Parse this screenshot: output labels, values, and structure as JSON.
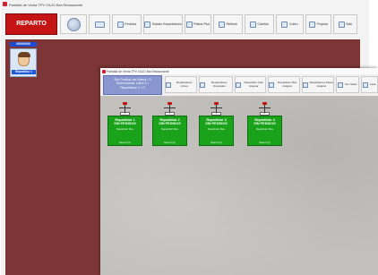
{
  "window_back": {
    "title": "Pantalla de Venta TPV XAJO Bar-Restaurante",
    "reparto_label": "REPARTO",
    "toolbar": [
      {
        "id": "home",
        "label": "",
        "icon": "round-logo-icon"
      },
      {
        "id": "keyboard",
        "label": "",
        "icon": "keyboard-icon"
      },
      {
        "id": "pedidos",
        "label": "Pedidos",
        "icon": "list-icon"
      },
      {
        "id": "estado",
        "label": "Estado Repartidores",
        "icon": "clipboard-icon"
      },
      {
        "id": "platos",
        "label": "Platos Plus",
        "icon": "plate-icon"
      },
      {
        "id": "refresh",
        "label": "Refresh",
        "icon": "refresh-icon"
      },
      {
        "id": "cambio",
        "label": "Cambio",
        "icon": "cash-icon"
      },
      {
        "id": "cobro",
        "label": "Cobro",
        "icon": "coin-icon"
      },
      {
        "id": "propina",
        "label": "Propina",
        "icon": "tip-icon"
      },
      {
        "id": "salir",
        "label": "Salir",
        "icon": "exit-icon"
      }
    ],
    "orders_header": "00000000",
    "driver_label": "Repartidor 1"
  },
  "window_front": {
    "title": "Pantalla de Venta TPV XAJO Bar-Restaurante",
    "selection_lines": [
      "Sin Pedido en Mesa / 0",
      "Seleccionar Libre 1 /",
      "Repartidor 1 / 0"
    ],
    "toolbar": [
      {
        "id": "tf1",
        "label": "Repartidores Libres",
        "icon": "list-icon"
      },
      {
        "id": "tf2",
        "label": "Repartidores Ocupados",
        "icon": "list-icon"
      },
      {
        "id": "tf3",
        "label": "Repartidor Auto Asignar",
        "icon": "list-icon"
      },
      {
        "id": "tf4",
        "label": "Repartidor Mas Asignar",
        "icon": "list-icon"
      },
      {
        "id": "tf5",
        "label": "Repartidores Mesa Asignar",
        "icon": "list-icon"
      },
      {
        "id": "tf6",
        "label": "Ver Notas",
        "icon": "note-icon"
      },
      {
        "id": "tf7",
        "label": "Lista",
        "icon": "list-icon"
      }
    ],
    "deliverers": [
      {
        "name1": "Repartidor 1",
        "name2": "SIN PEDIDOS",
        "sub": "Repartidor libre",
        "foot": "Mesa 0 (0)",
        "tag": "0"
      },
      {
        "name1": "Repartidor 2",
        "name2": "SIN PEDIDOS",
        "sub": "Repartidor libre",
        "foot": "Mesa 0 (0)",
        "tag": "0"
      },
      {
        "name1": "Repartidor 3",
        "name2": "SIN PEDIDOS",
        "sub": "Repartidor libre",
        "foot": "Mesa 0 (0)",
        "tag": "0"
      },
      {
        "name1": "Repartidor 4",
        "name2": "SIN PEDIDOS",
        "sub": "Repartidor libre",
        "foot": "Mesa 0 (0)",
        "tag": "0"
      }
    ]
  },
  "colors": {
    "reparto_red": "#c51414",
    "panel_maroon": "#7d3535",
    "driver_blue": "#1e5ad6",
    "card_green": "#1aa21a",
    "selection_purple": "#8a96cf"
  }
}
